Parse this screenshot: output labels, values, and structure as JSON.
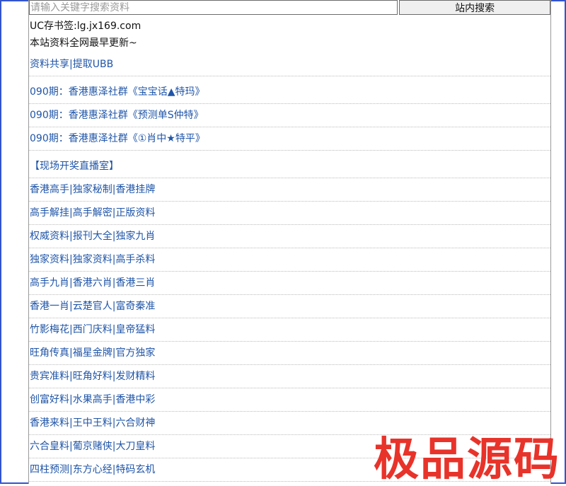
{
  "search": {
    "placeholder": "请输入关键字搜索资料",
    "button_label": "站内搜索"
  },
  "info": {
    "bookmark_line": "UC存书签:lg.jx169.com",
    "update_line": "本站资料全网最早更新~"
  },
  "share_links": [
    "资料共享",
    "提取UBB"
  ],
  "posts": [
    "090期：香港惠泽社群《宝宝话▲特玛》",
    "090期：香港惠泽社群《预测单S仲特》",
    "090期：香港惠泽社群《①肖中★特平》"
  ],
  "live_room": "【现场开奖直播室】",
  "link_rows": [
    [
      "香港高手",
      "独家秘制",
      "香港挂牌"
    ],
    [
      "高手解挂",
      "高手解密",
      "正版资料"
    ],
    [
      "权威资料",
      "报刊大全",
      "独家九肖"
    ],
    [
      "独家资料",
      "独家资料",
      "高手杀料"
    ],
    [
      "高手九肖",
      "香港六肖",
      "香港三肖"
    ],
    [
      "香港一肖",
      "云楚官人",
      "富奇秦准"
    ],
    [
      "竹影梅花",
      "西门庆料",
      "皇帝猛料"
    ],
    [
      "旺角传真",
      "福星金牌",
      "官方独家"
    ],
    [
      "贵宾准料",
      "旺角好料",
      "发财精料"
    ],
    [
      "创富好料",
      "水果高手",
      "香港中彩"
    ],
    [
      "香港来料",
      "王中王料",
      "六合财神"
    ],
    [
      "六合皇料",
      "葡京赌侠",
      "大刀皇料"
    ],
    [
      "四柱预测",
      "东方心经",
      "特码玄机"
    ]
  ],
  "watermark": "极品源码",
  "colors": {
    "link": "#1f55a8",
    "frame": "#3355cc",
    "watermark": "#e8332a"
  }
}
